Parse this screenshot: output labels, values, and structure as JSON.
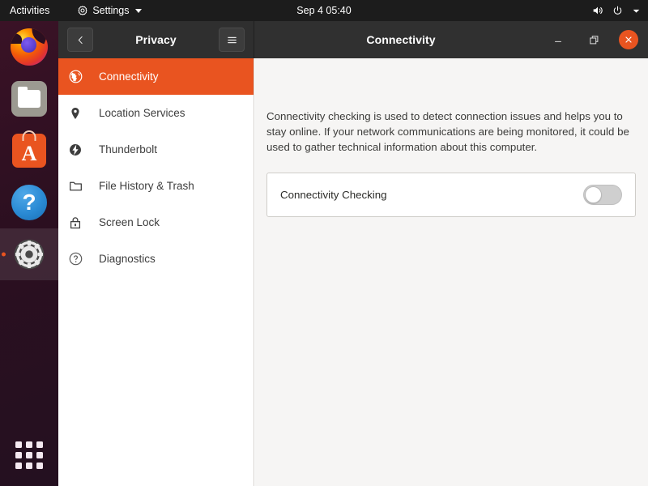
{
  "topbar": {
    "activities": "Activities",
    "app_menu": {
      "icon": "gear-icon",
      "label": "Settings"
    },
    "clock": "Sep 4  05:40",
    "status_icons": [
      "volume-icon",
      "power-icon",
      "chevron-down-icon"
    ]
  },
  "dock": {
    "items": [
      {
        "name": "firefox",
        "label": "Firefox",
        "running": false
      },
      {
        "name": "files",
        "label": "Files",
        "running": false
      },
      {
        "name": "ubuntu-software",
        "label": "Ubuntu Software",
        "running": false
      },
      {
        "name": "help",
        "label": "Help",
        "running": false
      },
      {
        "name": "settings",
        "label": "Settings",
        "running": true
      }
    ],
    "show_apps": {
      "label": "Show Applications",
      "icon": "grid-icon"
    }
  },
  "window": {
    "sidebar_header": {
      "back_icon": "chevron-left-icon",
      "title": "Privacy",
      "menu_icon": "hamburger-menu-icon"
    },
    "content_header": {
      "title": "Connectivity",
      "minimize_icon": "minimize-icon",
      "maximize_icon": "maximize-icon",
      "close_icon": "close-icon",
      "close_color": "#e95420"
    },
    "sidebar": {
      "selected_color": "#e95420",
      "items": [
        {
          "label": "Connectivity",
          "icon": "globe-icon",
          "selected": true
        },
        {
          "label": "Location Services",
          "icon": "location-pin-icon",
          "selected": false
        },
        {
          "label": "Thunderbolt",
          "icon": "thunderbolt-icon",
          "selected": false
        },
        {
          "label": "File History & Trash",
          "icon": "folder-icon",
          "selected": false
        },
        {
          "label": "Screen Lock",
          "icon": "lock-icon",
          "selected": false
        },
        {
          "label": "Diagnostics",
          "icon": "question-circle-icon",
          "selected": false
        }
      ]
    },
    "content": {
      "description": "Connectivity checking is used to detect connection issues and helps you to stay online. If your network communications are being monitored, it could be used to gather technical information about this computer.",
      "setting": {
        "label": "Connectivity Checking",
        "enabled": false
      }
    }
  }
}
